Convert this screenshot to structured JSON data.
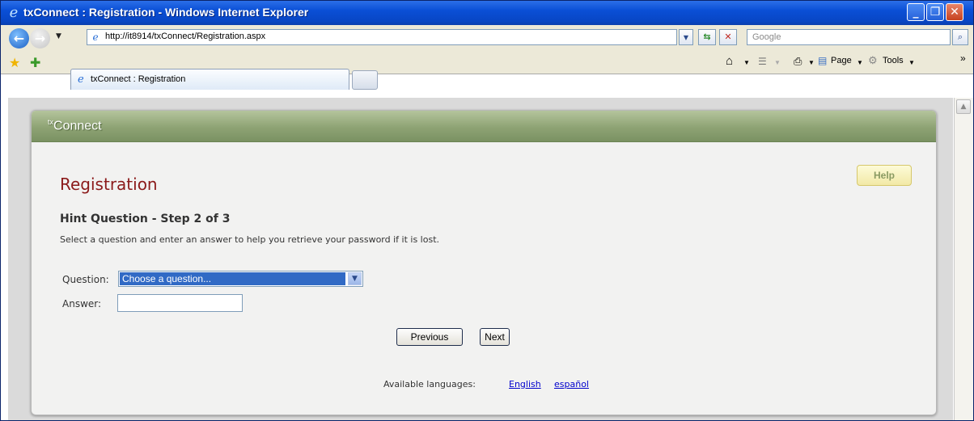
{
  "window": {
    "title": "txConnect : Registration - Windows Internet Explorer",
    "min_glyph": "_",
    "max_glyph": "❐",
    "close_glyph": "✕"
  },
  "address_bar": {
    "url": "http://it8914/txConnect/Registration.aspx",
    "search_placeholder": "Google"
  },
  "tabs": [
    {
      "label": "txConnect : Registration"
    }
  ],
  "toolbar": {
    "home_glyph": "⌂",
    "feeds_glyph": "☰",
    "print_glyph": "⎙",
    "page_label": "Page",
    "tools_label": "Tools",
    "more_glyph": "»"
  },
  "page": {
    "brand": "Connect",
    "brand_prefix": "tx",
    "help_label": "Help",
    "title": "Registration",
    "step_heading": "Hint Question - Step 2 of 3",
    "instructions": "Select a question and enter an answer to help you retrieve your password if it is lost.",
    "question_label": "Question:",
    "question_value": "Choose a question...",
    "answer_label": "Answer:",
    "answer_value": "",
    "previous_label": "Previous",
    "next_label": "Next",
    "languages_label": "Available languages:",
    "languages": [
      "English",
      "español"
    ]
  },
  "colors": {
    "title_bar": "#0a4fd6",
    "header_green": "#8ea374",
    "title_red": "#8b1a1a",
    "link_blue": "#0000cc",
    "select_highlight": "#316ac5"
  }
}
